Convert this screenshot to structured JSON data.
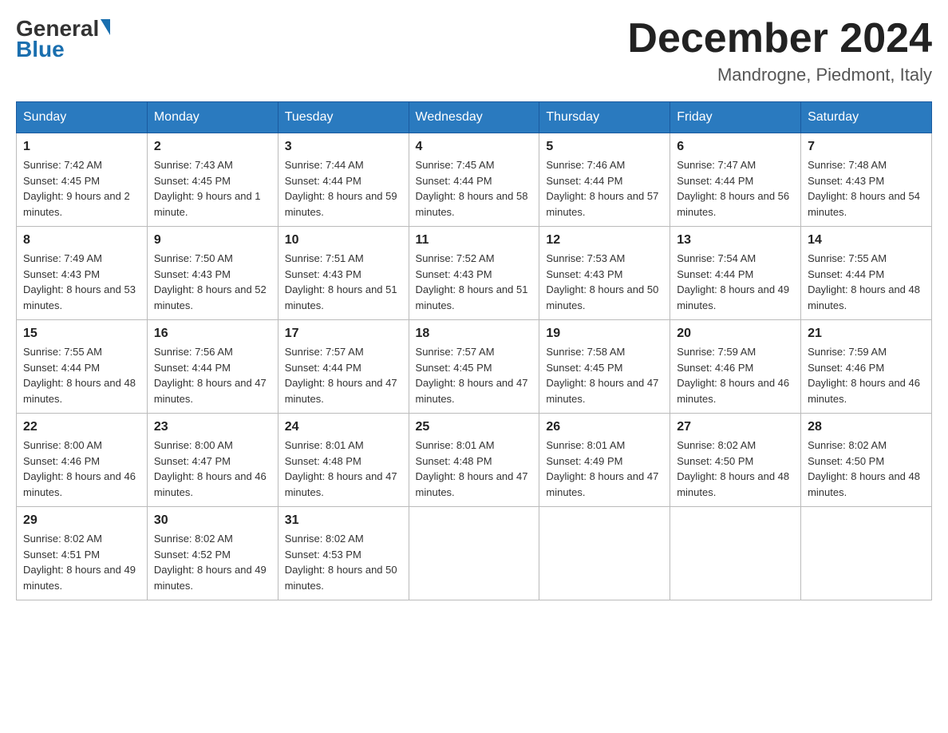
{
  "header": {
    "logo_general": "General",
    "logo_blue": "Blue",
    "month_title": "December 2024",
    "location": "Mandrogne, Piedmont, Italy"
  },
  "days_of_week": [
    "Sunday",
    "Monday",
    "Tuesday",
    "Wednesday",
    "Thursday",
    "Friday",
    "Saturday"
  ],
  "weeks": [
    [
      {
        "day": "1",
        "sunrise": "7:42 AM",
        "sunset": "4:45 PM",
        "daylight": "9 hours and 2 minutes."
      },
      {
        "day": "2",
        "sunrise": "7:43 AM",
        "sunset": "4:45 PM",
        "daylight": "9 hours and 1 minute."
      },
      {
        "day": "3",
        "sunrise": "7:44 AM",
        "sunset": "4:44 PM",
        "daylight": "8 hours and 59 minutes."
      },
      {
        "day": "4",
        "sunrise": "7:45 AM",
        "sunset": "4:44 PM",
        "daylight": "8 hours and 58 minutes."
      },
      {
        "day": "5",
        "sunrise": "7:46 AM",
        "sunset": "4:44 PM",
        "daylight": "8 hours and 57 minutes."
      },
      {
        "day": "6",
        "sunrise": "7:47 AM",
        "sunset": "4:44 PM",
        "daylight": "8 hours and 56 minutes."
      },
      {
        "day": "7",
        "sunrise": "7:48 AM",
        "sunset": "4:43 PM",
        "daylight": "8 hours and 54 minutes."
      }
    ],
    [
      {
        "day": "8",
        "sunrise": "7:49 AM",
        "sunset": "4:43 PM",
        "daylight": "8 hours and 53 minutes."
      },
      {
        "day": "9",
        "sunrise": "7:50 AM",
        "sunset": "4:43 PM",
        "daylight": "8 hours and 52 minutes."
      },
      {
        "day": "10",
        "sunrise": "7:51 AM",
        "sunset": "4:43 PM",
        "daylight": "8 hours and 51 minutes."
      },
      {
        "day": "11",
        "sunrise": "7:52 AM",
        "sunset": "4:43 PM",
        "daylight": "8 hours and 51 minutes."
      },
      {
        "day": "12",
        "sunrise": "7:53 AM",
        "sunset": "4:43 PM",
        "daylight": "8 hours and 50 minutes."
      },
      {
        "day": "13",
        "sunrise": "7:54 AM",
        "sunset": "4:44 PM",
        "daylight": "8 hours and 49 minutes."
      },
      {
        "day": "14",
        "sunrise": "7:55 AM",
        "sunset": "4:44 PM",
        "daylight": "8 hours and 48 minutes."
      }
    ],
    [
      {
        "day": "15",
        "sunrise": "7:55 AM",
        "sunset": "4:44 PM",
        "daylight": "8 hours and 48 minutes."
      },
      {
        "day": "16",
        "sunrise": "7:56 AM",
        "sunset": "4:44 PM",
        "daylight": "8 hours and 47 minutes."
      },
      {
        "day": "17",
        "sunrise": "7:57 AM",
        "sunset": "4:44 PM",
        "daylight": "8 hours and 47 minutes."
      },
      {
        "day": "18",
        "sunrise": "7:57 AM",
        "sunset": "4:45 PM",
        "daylight": "8 hours and 47 minutes."
      },
      {
        "day": "19",
        "sunrise": "7:58 AM",
        "sunset": "4:45 PM",
        "daylight": "8 hours and 47 minutes."
      },
      {
        "day": "20",
        "sunrise": "7:59 AM",
        "sunset": "4:46 PM",
        "daylight": "8 hours and 46 minutes."
      },
      {
        "day": "21",
        "sunrise": "7:59 AM",
        "sunset": "4:46 PM",
        "daylight": "8 hours and 46 minutes."
      }
    ],
    [
      {
        "day": "22",
        "sunrise": "8:00 AM",
        "sunset": "4:46 PM",
        "daylight": "8 hours and 46 minutes."
      },
      {
        "day": "23",
        "sunrise": "8:00 AM",
        "sunset": "4:47 PM",
        "daylight": "8 hours and 46 minutes."
      },
      {
        "day": "24",
        "sunrise": "8:01 AM",
        "sunset": "4:48 PM",
        "daylight": "8 hours and 47 minutes."
      },
      {
        "day": "25",
        "sunrise": "8:01 AM",
        "sunset": "4:48 PM",
        "daylight": "8 hours and 47 minutes."
      },
      {
        "day": "26",
        "sunrise": "8:01 AM",
        "sunset": "4:49 PM",
        "daylight": "8 hours and 47 minutes."
      },
      {
        "day": "27",
        "sunrise": "8:02 AM",
        "sunset": "4:50 PM",
        "daylight": "8 hours and 48 minutes."
      },
      {
        "day": "28",
        "sunrise": "8:02 AM",
        "sunset": "4:50 PM",
        "daylight": "8 hours and 48 minutes."
      }
    ],
    [
      {
        "day": "29",
        "sunrise": "8:02 AM",
        "sunset": "4:51 PM",
        "daylight": "8 hours and 49 minutes."
      },
      {
        "day": "30",
        "sunrise": "8:02 AM",
        "sunset": "4:52 PM",
        "daylight": "8 hours and 49 minutes."
      },
      {
        "day": "31",
        "sunrise": "8:02 AM",
        "sunset": "4:53 PM",
        "daylight": "8 hours and 50 minutes."
      },
      null,
      null,
      null,
      null
    ]
  ]
}
